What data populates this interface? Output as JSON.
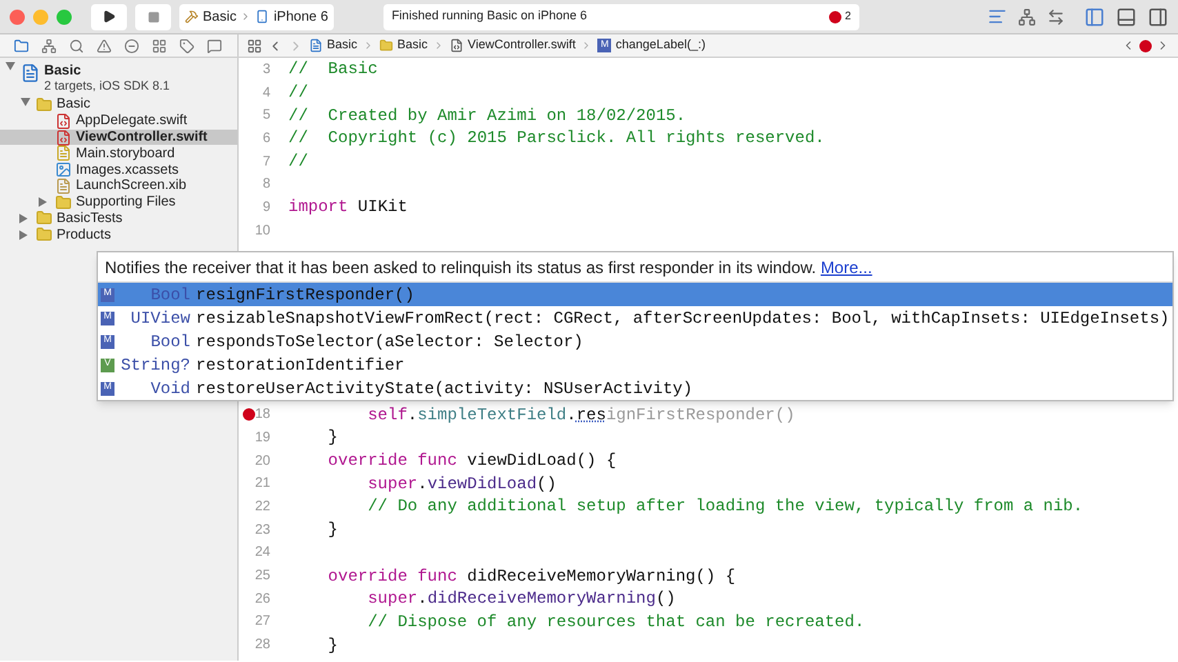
{
  "toolbar": {
    "scheme_project": "Basic",
    "scheme_device": "iPhone 6",
    "status": "Finished running Basic on iPhone 6",
    "error_count": "2"
  },
  "jump_bar": [
    {
      "kind": "project",
      "label": "Basic"
    },
    {
      "kind": "folder",
      "label": "Basic"
    },
    {
      "kind": "file",
      "label": "ViewController.swift"
    },
    {
      "kind": "method",
      "badge": "M",
      "label": "changeLabel(_:)"
    }
  ],
  "navigator": {
    "project": {
      "name": "Basic",
      "subtitle": "2 targets, iOS SDK 8.1",
      "expanded": true
    },
    "items": [
      {
        "kind": "folder",
        "name": "Basic",
        "expanded": true,
        "selected": false,
        "children": [
          {
            "kind": "swift",
            "name": "AppDelegate.swift",
            "selected": false
          },
          {
            "kind": "swift",
            "name": "ViewController.swift",
            "selected": true
          },
          {
            "kind": "storyboard",
            "name": "Main.storyboard",
            "selected": false
          },
          {
            "kind": "assets",
            "name": "Images.xcassets",
            "selected": false
          },
          {
            "kind": "xib",
            "name": "LaunchScreen.xib",
            "selected": false
          },
          {
            "kind": "folder",
            "name": "Supporting Files",
            "expanded": false,
            "selected": false
          }
        ]
      },
      {
        "kind": "folder",
        "name": "BasicTests",
        "expanded": false,
        "selected": false
      },
      {
        "kind": "folder",
        "name": "Products",
        "expanded": false,
        "selected": false
      }
    ]
  },
  "code_above": [
    {
      "number": "3",
      "segments": [
        {
          "kind": "comment",
          "text": "//  Basic"
        }
      ]
    },
    {
      "number": "4",
      "segments": [
        {
          "kind": "comment",
          "text": "//"
        }
      ]
    },
    {
      "number": "5",
      "segments": [
        {
          "kind": "comment",
          "text": "//  Created by Amir Azimi on 18/02/2015."
        }
      ]
    },
    {
      "number": "6",
      "segments": [
        {
          "kind": "comment",
          "text": "//  Copyright (c) 2015 Parsclick. All rights reserved."
        }
      ]
    },
    {
      "number": "7",
      "segments": [
        {
          "kind": "comment",
          "text": "//"
        }
      ]
    },
    {
      "number": "8"
    },
    {
      "number": "9",
      "segments": [
        {
          "kind": "keyword",
          "text": "import"
        },
        {
          "kind": "plain",
          "text": " UIKit"
        }
      ]
    },
    {
      "number": "10"
    }
  ],
  "completion": {
    "description": "Notifies the receiver that it has been asked to relinquish its status as first responder in its window.",
    "more_link": "More...",
    "items": [
      {
        "badge": "M",
        "kind": "method",
        "type": "Bool",
        "signature": "resignFirstResponder()",
        "selected": true
      },
      {
        "badge": "M",
        "kind": "method",
        "type": "UIView",
        "signature": "resizableSnapshotViewFromRect(rect: CGRect, afterScreenUpdates: Bool, withCapInsets: UIEdgeInsets)",
        "selected": false
      },
      {
        "badge": "M",
        "kind": "method",
        "type": "Bool",
        "signature": "respondsToSelector(aSelector: Selector)",
        "selected": false
      },
      {
        "badge": "V",
        "kind": "variable",
        "type": "String?",
        "signature": "restorationIdentifier",
        "selected": false
      },
      {
        "badge": "M",
        "kind": "method",
        "type": "Void",
        "signature": "restoreUserActivityState(activity: NSUserActivity)",
        "selected": false
      }
    ]
  },
  "code_below": [
    {
      "children": [
        {
          "number": "18",
          "error": true,
          "segments": [
            {
              "kind": "keyword",
              "text": "self"
            },
            {
              "kind": "plain",
              "text": "."
            },
            {
              "kind": "property",
              "text": "simpleTextField"
            },
            {
              "kind": "plain",
              "text": "."
            },
            {
              "kind": "typed",
              "text": "res"
            },
            {
              "kind": "ghost",
              "text": "ignFirstResponder()"
            }
          ]
        }
      ]
    },
    {
      "number": "19",
      "segments": [
        {
          "kind": "plain",
          "text": "}"
        }
      ]
    },
    {
      "number": "20",
      "segments": [
        {
          "kind": "keyword",
          "text": "override func"
        },
        {
          "kind": "plain",
          "text": " viewDidLoad() {"
        }
      ],
      "children": [
        {
          "number": "21",
          "segments": [
            {
              "kind": "keyword",
              "text": "super"
            },
            {
              "kind": "plain",
              "text": "."
            },
            {
              "kind": "method",
              "text": "viewDidLoad"
            },
            {
              "kind": "plain",
              "text": "()"
            }
          ]
        },
        {
          "number": "22",
          "segments": [
            {
              "kind": "comment",
              "text": "// Do any additional setup after loading the view, typically from a nib."
            }
          ]
        }
      ]
    },
    {
      "number": "23",
      "segments": [
        {
          "kind": "plain",
          "text": "}"
        }
      ]
    },
    {
      "number": "24"
    },
    {
      "number": "25",
      "segments": [
        {
          "kind": "keyword",
          "text": "override func"
        },
        {
          "kind": "plain",
          "text": " didReceiveMemoryWarning() {"
        }
      ],
      "children": [
        {
          "number": "26",
          "segments": [
            {
              "kind": "keyword",
              "text": "super"
            },
            {
              "kind": "plain",
              "text": "."
            },
            {
              "kind": "method",
              "text": "didReceiveMemoryWarning"
            },
            {
              "kind": "plain",
              "text": "()"
            }
          ]
        },
        {
          "number": "27",
          "segments": [
            {
              "kind": "comment",
              "text": "// Dispose of any resources that can be recreated."
            }
          ]
        }
      ]
    },
    {
      "number": "28",
      "segments": [
        {
          "kind": "plain",
          "text": "}"
        }
      ]
    }
  ]
}
